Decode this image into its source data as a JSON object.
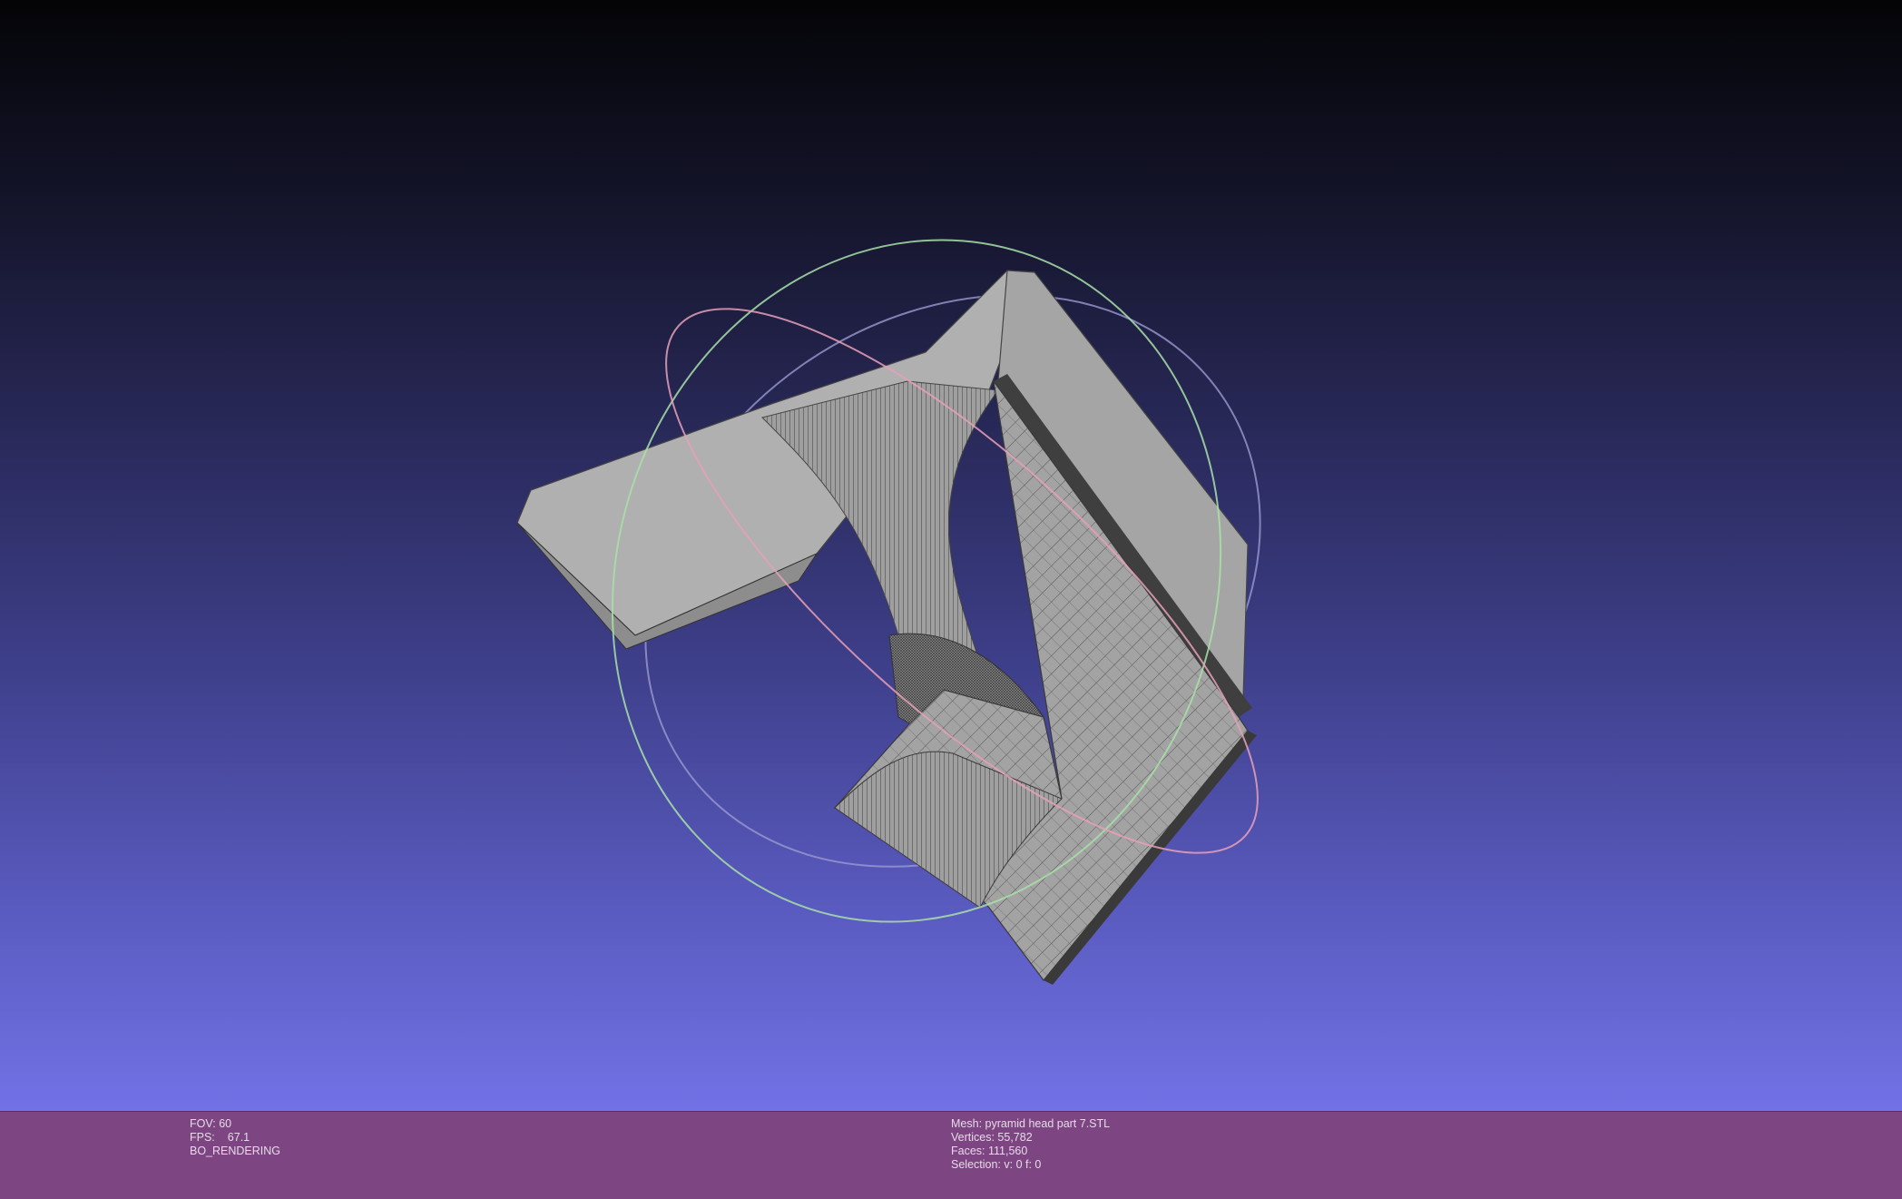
{
  "app": {
    "name": "MeshLab viewport"
  },
  "viewport": {
    "background_top": "#040407",
    "background_bottom": "#7272e6",
    "mesh_color": "#a7a7a7",
    "wire_color": "#3a3a3a",
    "trackball": {
      "x_ring_color": "#e8a0b8",
      "y_ring_color": "#a8e0a8",
      "z_ring_color": "#b0b0e8"
    }
  },
  "info_left": {
    "fov_label": "FOV:",
    "fov_value": "60",
    "fps_label": "FPS:",
    "fps_value": "67.1",
    "mode": "BO_RENDERING"
  },
  "info_right": {
    "mesh_label": "Mesh:",
    "mesh_name": "pyramid head part 7.STL",
    "vertices_label": "Vertices:",
    "vertices": "55,782",
    "faces_label": "Faces:",
    "faces": "111,560",
    "selection_label": "Selection:",
    "selection": "v: 0 f: 0"
  },
  "colors": {
    "infobar": "#7e4583",
    "infobar_text": "#e6dbe8"
  }
}
